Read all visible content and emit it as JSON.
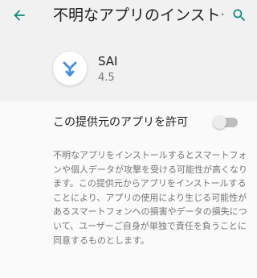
{
  "toolbar": {
    "back_icon": "arrow-back-icon",
    "title": "不明なアプリのインストール",
    "search_icon": "search-icon",
    "accent_color": "#00897b"
  },
  "app": {
    "name": "SAI",
    "version": "4.5",
    "icon": "sai-logo-icon",
    "icon_color": "#4a90e2"
  },
  "setting": {
    "label": "この提供元のアプリを許可",
    "enabled": false
  },
  "description": "不明なアプリをインストールするとスマートフォンや個人データが攻撃を受ける可能性が高くなります。この提供元からアプリをインストールすることにより、アプリの使用により生じる可能性があるスマートフォンへの損害やデータの損失について、ユーザーご自身が単独で責任を負うことに同意するものとします。"
}
